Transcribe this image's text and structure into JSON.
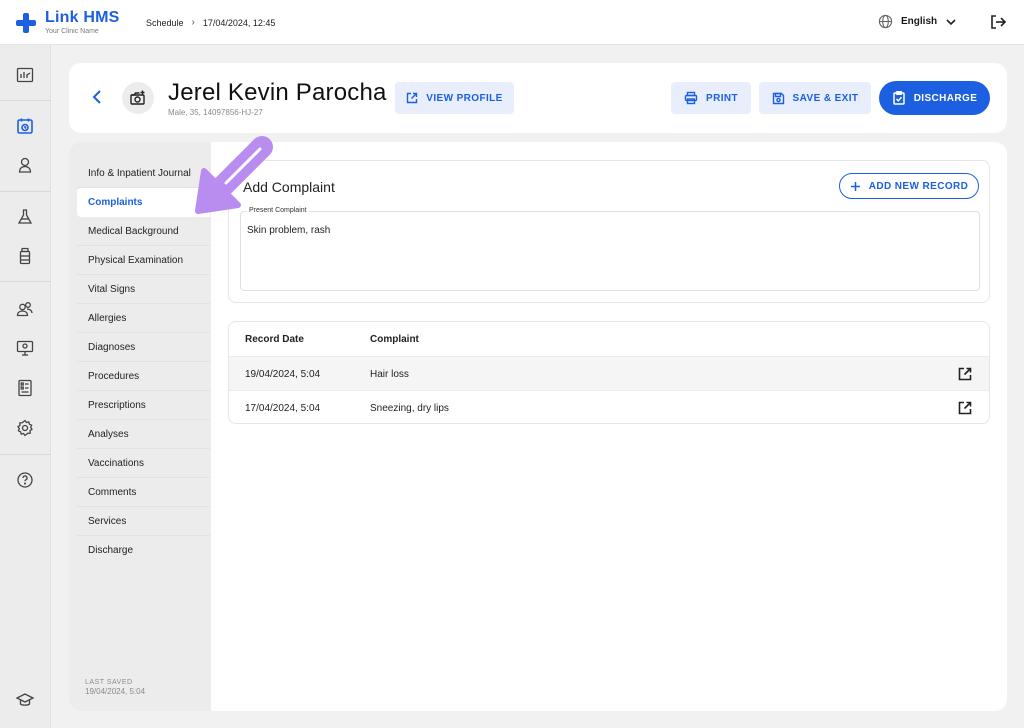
{
  "app": {
    "name": "Link HMS",
    "clinic": "Your Clinic Name"
  },
  "breadcrumb": {
    "section": "Schedule",
    "datetime": "17/04/2024, 12:45"
  },
  "language": {
    "selected": "English"
  },
  "rail": {
    "icons": [
      "dashboard-icon",
      "calendar-icon",
      "user-icon",
      "flask-icon",
      "medicine-icon",
      "users-icon",
      "monitor-icon",
      "report-icon",
      "settings-icon",
      "help-icon",
      "graduation-cap-icon"
    ],
    "active": "calendar-icon"
  },
  "patient": {
    "name": "Jerel Kevin Parocha",
    "meta": "Male, 35, 14097856-HJ-27"
  },
  "actions": {
    "view_profile": "VIEW PROFILE",
    "print": "PRINT",
    "save_exit": "SAVE & EXIT",
    "discharge": "DISCHARGE"
  },
  "sidenav": {
    "items": [
      "Info & Inpatient Journal",
      "Complaints",
      "Medical Background",
      "Physical Examination",
      "Vital Signs",
      "Allergies",
      "Diagnoses",
      "Procedures",
      "Prescriptions",
      "Analyses",
      "Vaccinations",
      "Comments",
      "Services",
      "Discharge"
    ],
    "active": "Complaints",
    "last_saved_label": "LAST SAVED",
    "last_saved_value": "19/04/2024, 5:04"
  },
  "complaint_form": {
    "title": "Add Complaint",
    "add_button": "ADD NEW RECORD",
    "field_label": "Present Complaint",
    "field_value": "Skin problem, rash"
  },
  "records": {
    "columns": [
      "Record Date",
      "Complaint"
    ],
    "rows": [
      {
        "date": "19/04/2024, 5:04",
        "complaint": "Hair loss"
      },
      {
        "date": "17/04/2024, 5:04",
        "complaint": "Sneezing, dry lips"
      }
    ]
  },
  "colors": {
    "brand": "#1c5fe0",
    "arrow": "#b98cf0"
  }
}
